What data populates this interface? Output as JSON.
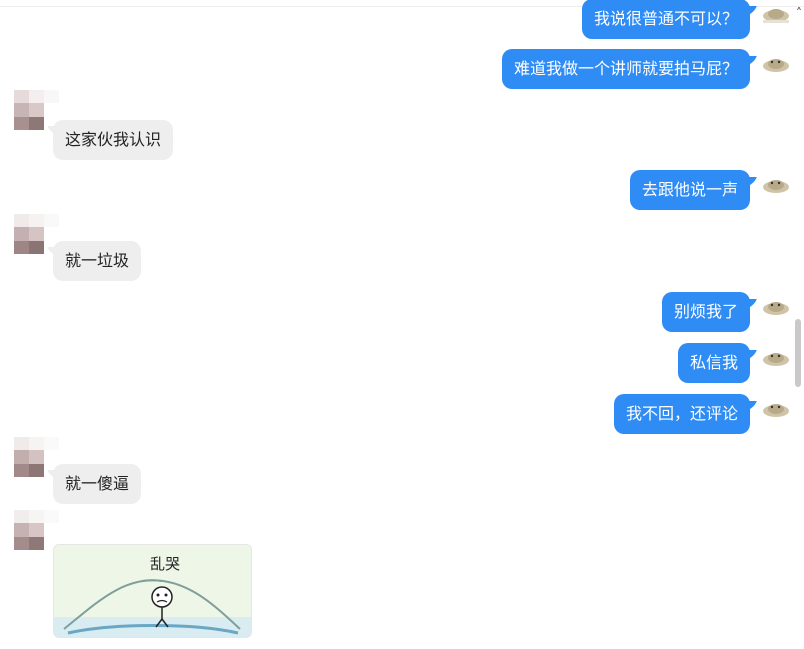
{
  "colors": {
    "outgoing_bubble": "#2f8cf5",
    "incoming_bubble": "#eeeeee"
  },
  "icons": {
    "self_avatar": "cat-avatar-icon",
    "other_avatar": "pixelated-avatar-icon",
    "scroll_up": "chevron-up-icon"
  },
  "messages": [
    {
      "side": "out",
      "text": "我说很普通不可以？"
    },
    {
      "side": "out",
      "text": "难道我做一个讲师就要拍马屁？"
    },
    {
      "side": "in",
      "text": "这家伙我认识"
    },
    {
      "side": "out",
      "text": "去跟他说一声"
    },
    {
      "side": "in",
      "text": "就一垃圾"
    },
    {
      "side": "out",
      "text": "别烦我了"
    },
    {
      "side": "out",
      "text": "私信我"
    },
    {
      "side": "out",
      "text": "我不回，还评论"
    },
    {
      "side": "in",
      "text": "就一傻逼"
    },
    {
      "side": "in",
      "type": "sticker",
      "caption": "乱哭"
    }
  ]
}
